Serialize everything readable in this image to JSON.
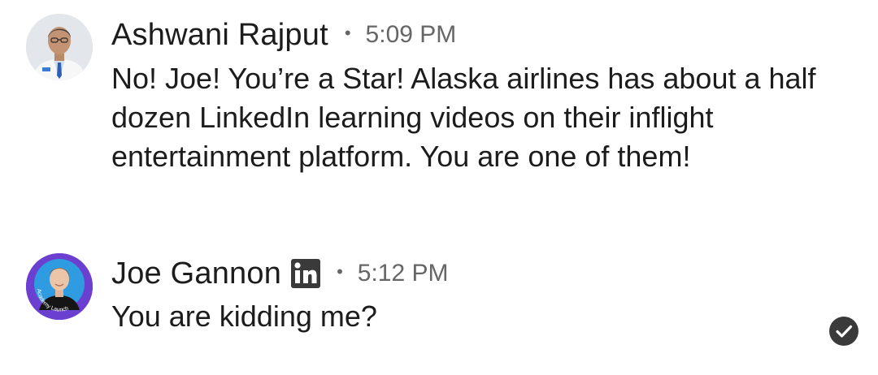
{
  "messages": [
    {
      "sender": "Ashwani Rajput",
      "timestamp": "5:09 PM",
      "separator": "•",
      "text": "No! Joe! You’re a Star! Alaska airlines has about a half dozen LinkedIn learning videos on their inflight entertainment platform. You are one of them!",
      "avatar_icon": "person-photo-avatar",
      "badge": null
    },
    {
      "sender": "Joe Gannon",
      "timestamp": "5:12 PM",
      "separator": "•",
      "text": "You are kidding me?",
      "avatar_icon": "person-photo-avatar",
      "avatar_ring_text": "Academy Launch",
      "badge": "linkedin-icon"
    }
  ],
  "read_receipt_icon": "check-circle-icon",
  "colors": {
    "text_primary": "#1c1c1c",
    "text_secondary": "#666666",
    "avatar_ring_purple": "#6b3fd0",
    "read_receipt_bg": "#3a3a3a"
  }
}
